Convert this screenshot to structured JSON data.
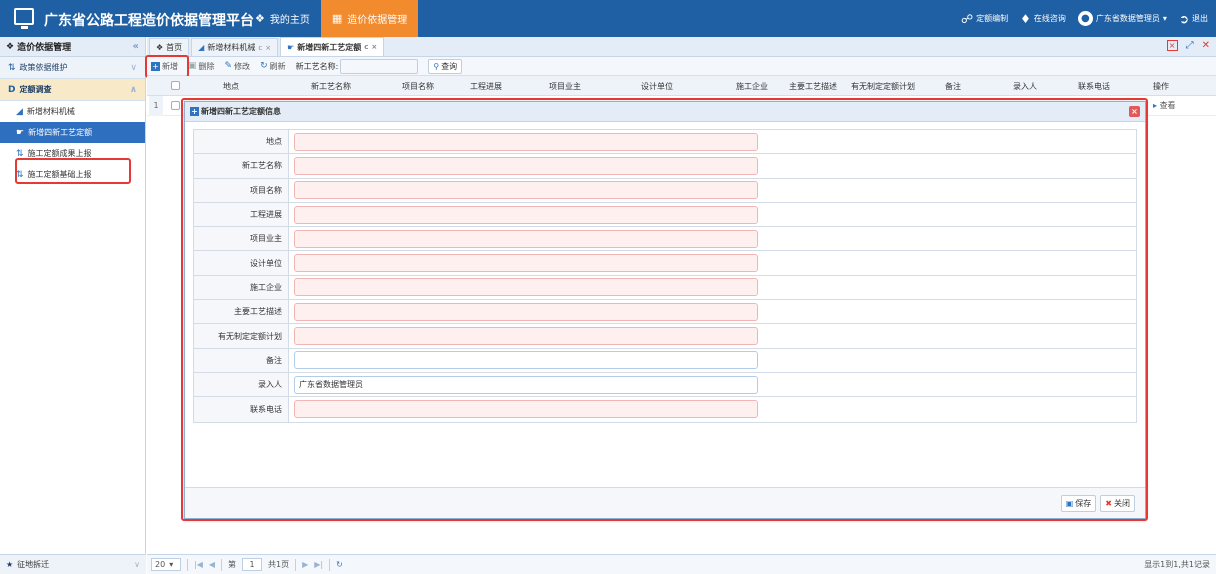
{
  "header": {
    "app_title": "广东省公路工程造价依据管理平台",
    "nav": [
      {
        "label": "我的主页"
      },
      {
        "label": "造价依据管理"
      }
    ],
    "right": {
      "quota": "定额编制",
      "consult": "在线咨询",
      "user": "广东省数据管理员",
      "logout": "退出"
    }
  },
  "sidebar": {
    "title": "造价依据管理",
    "groups": [
      {
        "label": "政策依据维护"
      },
      {
        "label": "定额调查"
      }
    ],
    "items": [
      {
        "label": "新增材料机械"
      },
      {
        "label": "新增四新工艺定额"
      },
      {
        "label": "施工定额成果上报"
      },
      {
        "label": "施工定额基础上报"
      }
    ],
    "footer": "征地拆迁"
  },
  "tabs": [
    {
      "label": "首页"
    },
    {
      "label": "新增材料机械"
    },
    {
      "label": "新增四新工艺定额"
    }
  ],
  "toolbar": {
    "add": "新增",
    "delete": "删除",
    "edit": "修改",
    "refresh": "刷新",
    "search_label": "新工艺名称:",
    "query": "查询"
  },
  "grid": {
    "columns": [
      "地点",
      "新工艺名称",
      "项目名称",
      "工程进展",
      "项目业主",
      "设计单位",
      "施工企业",
      "主要工艺描述",
      "有无制定定额计划",
      "备注",
      "录入人",
      "联系电话",
      "操作"
    ],
    "rows": [
      {
        "num": "1",
        "action": "查看"
      }
    ]
  },
  "pager": {
    "page_size": "20",
    "page_prefix": "第",
    "page": "1",
    "page_suffix": "共1页",
    "info": "显示1到1,共1记录"
  },
  "dialog": {
    "title": "新增四新工艺定额信息",
    "fields": [
      {
        "label": "地点",
        "value": ""
      },
      {
        "label": "新工艺名称",
        "value": ""
      },
      {
        "label": "项目名称",
        "value": ""
      },
      {
        "label": "工程进展",
        "value": ""
      },
      {
        "label": "项目业主",
        "value": ""
      },
      {
        "label": "设计单位",
        "value": ""
      },
      {
        "label": "施工企业",
        "value": ""
      },
      {
        "label": "主要工艺描述",
        "value": ""
      },
      {
        "label": "有无制定定额计划",
        "value": ""
      },
      {
        "label": "备注",
        "value": ""
      },
      {
        "label": "录入人",
        "value": "广东省数据管理员"
      },
      {
        "label": "联系电话",
        "value": ""
      }
    ],
    "save": "保存",
    "close": "关闭"
  },
  "colors": {
    "header_bg": "#1f5fa3",
    "active_nav": "#f28a2e",
    "highlight_outline": "#e53935"
  }
}
